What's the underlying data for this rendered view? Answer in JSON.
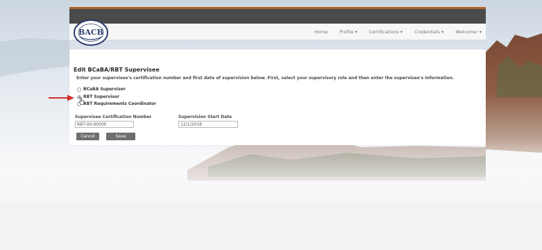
{
  "nav": {
    "logo_text": "BACB",
    "logo_ring_text": "BEHAVIOR ANALYST CERTIFICATION BOARD",
    "items": [
      {
        "label": "Home"
      },
      {
        "label": "Profile ▾"
      },
      {
        "label": "Certifications ▾"
      },
      {
        "label": "Credentials ▾"
      },
      {
        "label": "Welcome! ▾"
      }
    ]
  },
  "form": {
    "title": "Edit BCaBA/RBT Supervisee",
    "instructions": "Enter your supervisee's certification number and first date of supervision below. First, select your supervisory role and then enter the supervisee's information.",
    "roles": [
      {
        "label": "BCaBA Supervisor",
        "checked": false
      },
      {
        "label": "RBT Supervisor",
        "checked": true
      },
      {
        "label": "RBT Requirements Coordinator",
        "checked": false
      }
    ],
    "cert_label": "Supervisee Certification Number",
    "cert_placeholder": "RBT-00-00000",
    "date_label": "Supervision Start Date",
    "date_value": "12/1/2018",
    "cancel_label": "Cancel",
    "save_label": "Save"
  },
  "colors": {
    "nav_accent": "#b0632b",
    "nav_band": "#4a4a4a",
    "button": "#6e6e6e",
    "arrow": "#d32f2f"
  }
}
